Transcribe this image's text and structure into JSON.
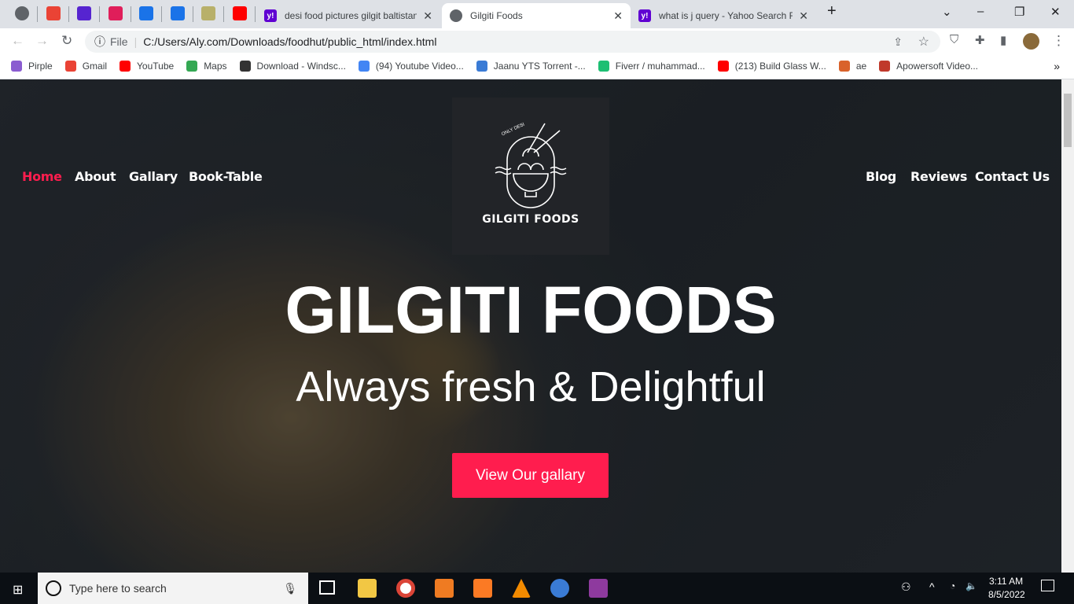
{
  "browser": {
    "pinned_tabs": [
      {
        "icon": "globe-icon",
        "color": "#5f6368"
      },
      {
        "icon": "gmail-icon",
        "color": "#ea4335"
      },
      {
        "icon": "udemy-icon",
        "color": "#5624d0"
      },
      {
        "icon": "slack-icon",
        "color": "#e01e5a"
      },
      {
        "icon": "settings-icon",
        "color": "#1a73e8"
      },
      {
        "icon": "loading-icon",
        "color": "#1a73e8"
      },
      {
        "icon": "css-icon",
        "color": "#b8b06a"
      },
      {
        "icon": "youtube-icon",
        "color": "#ff0000"
      }
    ],
    "tabs": [
      {
        "title": "desi food pictures gilgit baltistan",
        "icon": "yahoo-icon"
      },
      {
        "title": "Gilgiti Foods",
        "icon": "globe-icon"
      },
      {
        "title": "what is j query - Yahoo Search Re",
        "icon": "yahoo-icon"
      }
    ],
    "address": {
      "scheme": "File",
      "url": "C:/Users/Aly.com/Downloads/foodhut/public_html/index.html"
    },
    "bookmarks": [
      {
        "label": "Pirple",
        "color": "#8a5cd0"
      },
      {
        "label": "Gmail",
        "color": "#ea4335"
      },
      {
        "label": "YouTube",
        "color": "#ff0000"
      },
      {
        "label": "Maps",
        "color": "#34a853"
      },
      {
        "label": "Download - Windsc...",
        "color": "#333"
      },
      {
        "label": "(94) Youtube Video...",
        "color": "#4285f4"
      },
      {
        "label": "Jaanu YTS Torrent -...",
        "color": "#3a7bd5"
      },
      {
        "label": "Fiverr / muhammad...",
        "color": "#1dbf73"
      },
      {
        "label": "(213) Build Glass W...",
        "color": "#ff0000"
      },
      {
        "label": "ae",
        "color": "#d9622b"
      },
      {
        "label": "Apowersoft Video...",
        "color": "#c0392b"
      }
    ],
    "more": "»"
  },
  "site": {
    "nav_left": [
      "Home",
      "About",
      "Gallary",
      "Book-Table"
    ],
    "nav_right": [
      "Blog",
      "Reviews",
      "Contact Us"
    ],
    "active_color": "#ff1d4e",
    "logo": {
      "top_text": "ONLY DESI",
      "name": "GILGITI FOODS"
    },
    "title": "GILGITI FOODS",
    "subtitle": "Always fresh & Delightful",
    "cta": "View Our gallary"
  },
  "taskbar": {
    "search_placeholder": "Type here to search",
    "time": "3:11 AM",
    "date": "8/5/2022"
  }
}
